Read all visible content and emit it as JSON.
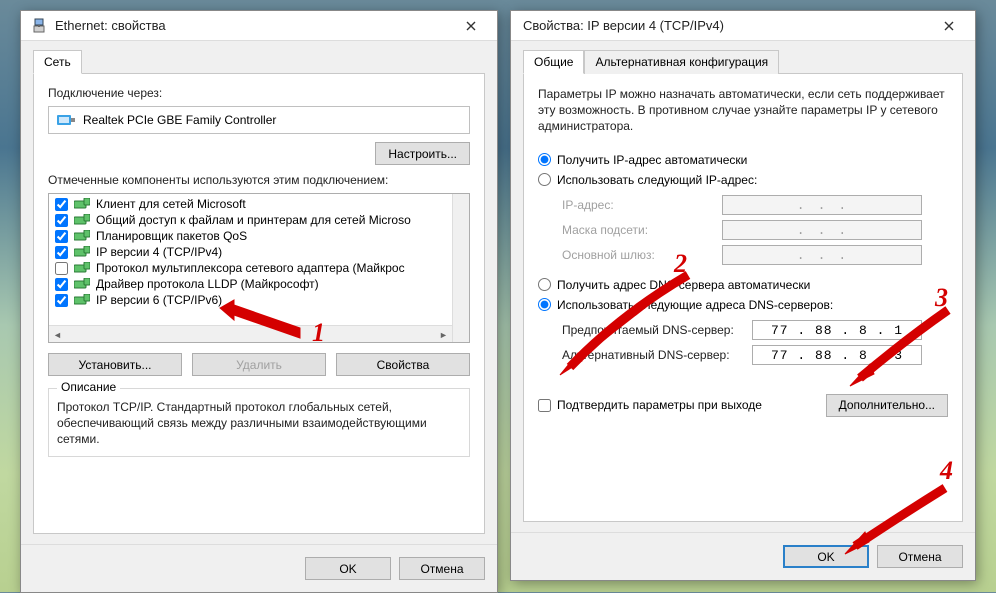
{
  "left": {
    "title": "Ethernet: свойства",
    "tab_net": "Сеть",
    "connect_via_label": "Подключение через:",
    "adapter_name": "Realtek PCIe GBE Family Controller",
    "configure_btn": "Настроить...",
    "components_label": "Отмеченные компоненты используются этим подключением:",
    "components": [
      {
        "checked": true,
        "label": "Клиент для сетей Microsoft"
      },
      {
        "checked": true,
        "label": "Общий доступ к файлам и принтерам для сетей Microso"
      },
      {
        "checked": true,
        "label": "Планировщик пакетов QoS"
      },
      {
        "checked": true,
        "label": "IP версии 4 (TCP/IPv4)"
      },
      {
        "checked": false,
        "label": "Протокол мультиплексора сетевого адаптера (Майкрос"
      },
      {
        "checked": true,
        "label": "Драйвер протокола LLDP (Майкрософт)"
      },
      {
        "checked": true,
        "label": "IP версии 6 (TCP/IPv6)"
      }
    ],
    "install_btn": "Установить...",
    "remove_btn": "Удалить",
    "properties_btn": "Свойства",
    "description_title": "Описание",
    "description_text": "Протокол TCP/IP. Стандартный протокол глобальных сетей, обеспечивающий связь между различными взаимодействующими сетями.",
    "ok_btn": "OK",
    "cancel_btn": "Отмена"
  },
  "right": {
    "title": "Свойства: IP версии 4 (TCP/IPv4)",
    "tab_general": "Общие",
    "tab_alt": "Альтернативная конфигурация",
    "info_text": "Параметры IP можно назначать автоматически, если сеть поддерживает эту возможность. В противном случае узнайте параметры IP у сетевого администратора.",
    "radio_ip_auto": "Получить IP-адрес автоматически",
    "radio_ip_manual": "Использовать следующий IP-адрес:",
    "ip_label": "IP-адрес:",
    "mask_label": "Маска подсети:",
    "gateway_label": "Основной шлюз:",
    "radio_dns_auto": "Получить адрес DNS-сервера автоматически",
    "radio_dns_manual": "Использовать следующие адреса DNS-серверов:",
    "dns1_label": "Предпочитаемый DNS-сервер:",
    "dns2_label": "Альтернативный DNS-сервер:",
    "dns1_value": "77 . 88 .  8 .  1",
    "dns2_value": "77 . 88 .  8 .  3",
    "validate_label": "Подтвердить параметры при выходе",
    "advanced_btn": "Дополнительно...",
    "ok_btn": "OK",
    "cancel_btn": "Отмена"
  },
  "annotations": {
    "n1": "1",
    "n2": "2",
    "n3": "3",
    "n4": "4"
  }
}
